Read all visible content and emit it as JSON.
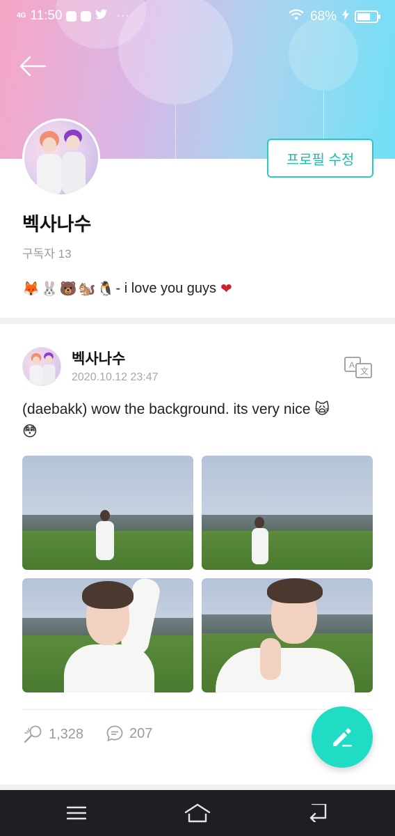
{
  "status_bar": {
    "network": "4G",
    "time": "11:50",
    "dots": "···",
    "battery_percent": "68%",
    "battery_level": 0.68
  },
  "profile": {
    "edit_button": "프로필 수정",
    "name": "벡사나수",
    "subscribers": "구독자 13",
    "bio_emojis": [
      "🦊",
      "🐰",
      "🐻",
      "🐿️",
      "🐧"
    ],
    "bio_text": "- i love you guys",
    "bio_heart": "❤"
  },
  "post": {
    "author": "벡사나수",
    "date": "2020.10.12 23:47",
    "text_main": "(daebakk) wow the background. its very nice ",
    "text_emoji_1": "🙀",
    "text_emoji_2": "😳",
    "likes": "1,328",
    "comments": "207"
  },
  "icons": {
    "back": "arrow-left-icon",
    "translate": "translate-icon",
    "like": "lightstick-icon",
    "comment": "comment-icon",
    "write": "pencil-icon"
  },
  "colors": {
    "accent": "#20dcc4",
    "edit_border": "#26cdbf",
    "navbar": "#1f1f23"
  }
}
